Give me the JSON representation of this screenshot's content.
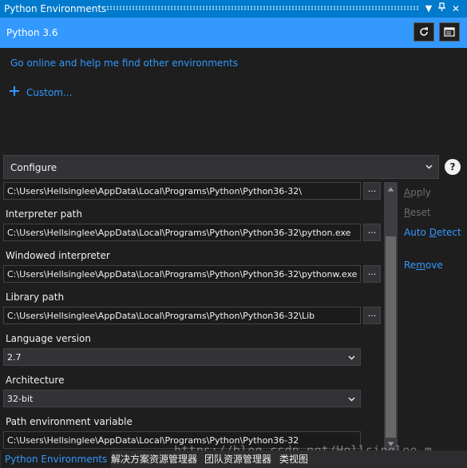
{
  "window": {
    "title": "Python Environments"
  },
  "environment": {
    "name": "Python 3.6"
  },
  "links": {
    "go_online": "Go online and help me find other environments",
    "custom": "Custom..."
  },
  "configure": {
    "label": "Configure"
  },
  "help": {
    "label": "?"
  },
  "fields": {
    "prefix_path": "C:\\Users\\Hellsinglee\\AppData\\Local\\Programs\\Python\\Python36-32\\",
    "interpreter_label": "Interpreter path",
    "interpreter_value": "C:\\Users\\Hellsinglee\\AppData\\Local\\Programs\\Python\\Python36-32\\python.exe",
    "windowed_label": "Windowed interpreter",
    "windowed_value": "C:\\Users\\Hellsinglee\\AppData\\Local\\Programs\\Python\\Python36-32\\pythonw.exe",
    "library_label": "Library path",
    "library_value": "C:\\Users\\Hellsinglee\\AppData\\Local\\Programs\\Python\\Python36-32\\Lib",
    "language_label": "Language version",
    "language_value": "2.7",
    "architecture_label": "Architecture",
    "architecture_value": "32-bit",
    "path_var_label": "Path environment variable",
    "path_var_value": "C:\\Users\\Hellsinglee\\AppData\\Local\\Programs\\Python\\Python36-32",
    "browse_label": "..."
  },
  "actions": {
    "apply_first": "A",
    "apply_rest": "pply",
    "reset_first": "R",
    "reset_rest": "eset",
    "auto_first": "Auto ",
    "auto_ul": "D",
    "auto_rest": "etect",
    "remove_first": "Re",
    "remove_ul": "m",
    "remove_rest": "ove"
  },
  "tabs": [
    "Python Environments",
    "解决方案资源管理器",
    "团队资源管理器",
    "类视图"
  ],
  "watermark": "https://blog.csdn.net/Hellsinglee_m",
  "colors": {
    "accent": "#3399ff",
    "titlebar": "#007acc",
    "background": "#1e1e1e"
  }
}
